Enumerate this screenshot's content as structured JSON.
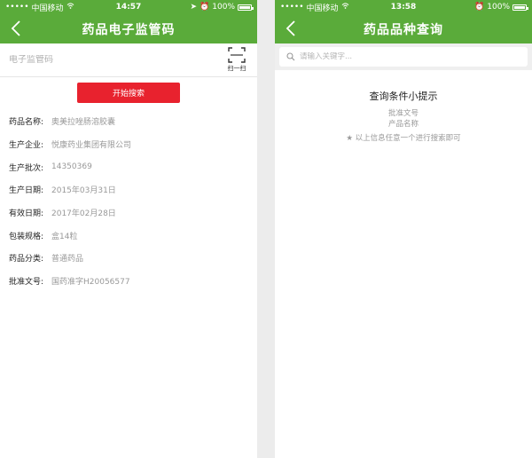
{
  "left": {
    "status": {
      "carrier": "中国移动",
      "time": "14:57",
      "battery": "100%"
    },
    "nav": {
      "title": "药品电子监管码"
    },
    "code_input": {
      "placeholder": "电子监管码",
      "value": ""
    },
    "scan_label": "扫一扫",
    "search_button": "开始搜索",
    "info": [
      {
        "label": "药品名称:",
        "value": "奥美拉唑肠溶胶囊"
      },
      {
        "label": "生产企业:",
        "value": "悦康药业集团有限公司"
      },
      {
        "label": "生产批次:",
        "value": "14350369"
      },
      {
        "label": "生产日期:",
        "value": "2015年03月31日"
      },
      {
        "label": "有效日期:",
        "value": "2017年02月28日"
      },
      {
        "label": "包装规格:",
        "value": "盒14粒"
      },
      {
        "label": "药品分类:",
        "value": "普通药品"
      },
      {
        "label": "批准文号:",
        "value": "国药准字H20056577"
      }
    ]
  },
  "right": {
    "status": {
      "carrier": "中国移动",
      "time": "13:58",
      "battery": "100%"
    },
    "nav": {
      "title": "药品品种查询"
    },
    "search": {
      "placeholder": "请输入关键字...",
      "value": ""
    },
    "tips": {
      "title": "查询条件小提示",
      "lines": [
        "批准文号",
        "产品名称"
      ],
      "note": "★ 以上信息任意一个进行搜索即可"
    }
  },
  "colors": {
    "brand_green": "#5aab3a",
    "button_red": "#e8222e"
  }
}
